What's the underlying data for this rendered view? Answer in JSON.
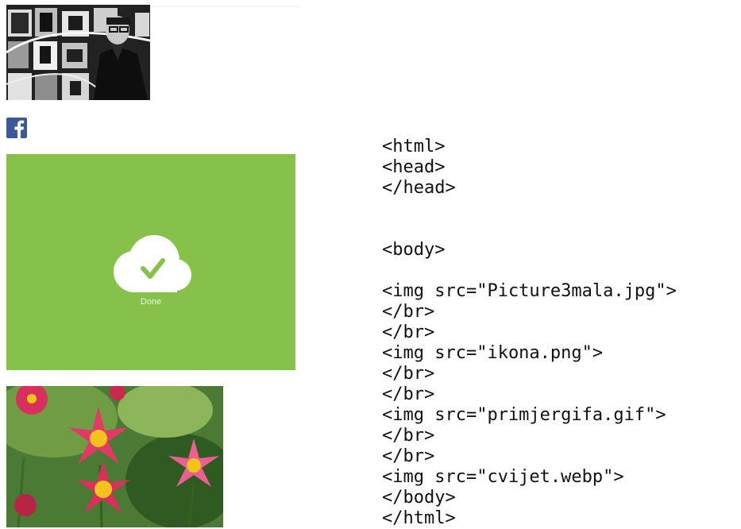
{
  "images": {
    "portrait": {
      "icon": "portrait-photo"
    },
    "facebook": {
      "icon": "facebook-icon",
      "color": "#3b5998"
    },
    "done": {
      "label": "Done",
      "background": "#86c24a",
      "icon": "cloud-check-icon"
    },
    "flower": {
      "icon": "flower-photo"
    }
  },
  "code": {
    "lines": [
      "<html>",
      "<head>",
      "</head>",
      "",
      "",
      "<body>",
      "",
      "<img src=\"Picture3mala.jpg\">",
      "</br>",
      "</br>",
      "<img src=\"ikona.png\">",
      "</br>",
      "</br>",
      "<img src=\"primjergifa.gif\">",
      "</br>",
      "</br>",
      "<img src=\"cvijet.webp\">",
      "</body>",
      "</html>"
    ]
  }
}
